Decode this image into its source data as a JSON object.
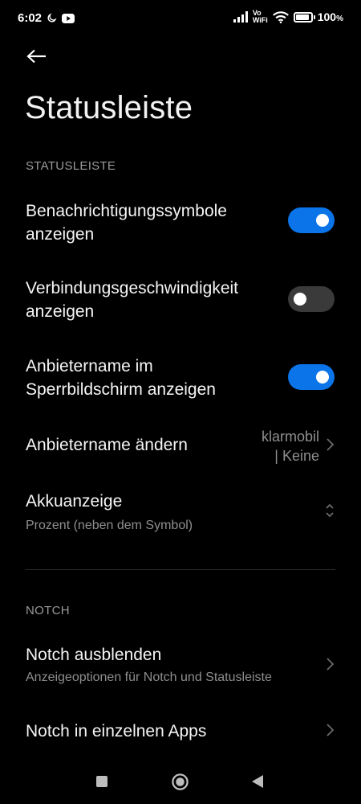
{
  "status_bar": {
    "time": "6:02",
    "vowifi_top": "Vo",
    "vowifi_bottom": "WiFi",
    "battery_text": "100",
    "battery_level": 1.0,
    "icons": [
      "moon-icon",
      "youtube-icon",
      "signal-icon",
      "vowifi-icon",
      "wifi-icon",
      "battery-icon"
    ]
  },
  "header": {
    "back_icon": "back-arrow-icon",
    "title": "Statusleiste"
  },
  "sections": {
    "statusleiste_header": "STATUSLEISTE",
    "notch_header": "NOTCH"
  },
  "settings": {
    "notification_icons": {
      "line1": "Benachrichtigungssymbole",
      "line2": "anzeigen",
      "enabled": true
    },
    "connection_speed": {
      "line1": "Verbindungsgeschwindigkeit",
      "line2": "anzeigen",
      "enabled": false
    },
    "carrier_lockscreen": {
      "line1": "Anbietername im",
      "line2": "Sperrbildschirm anzeigen",
      "enabled": true
    },
    "carrier_name": {
      "title": "Anbietername ändern",
      "value_line1": "klarmobil",
      "value_line2": "| Keine"
    },
    "battery_indicator": {
      "title": "Akkuanzeige",
      "subtitle": "Prozent (neben dem Symbol)"
    },
    "hide_notch": {
      "title": "Notch ausblenden",
      "subtitle": "Anzeigeoptionen für Notch und Statusleiste"
    },
    "notch_apps": {
      "title": "Notch in einzelnen Apps"
    }
  },
  "nav_bar": {
    "icons": [
      "recents-square-icon",
      "home-circle-icon",
      "back-triangle-icon"
    ]
  },
  "colors": {
    "background": "#000000",
    "accent": "#0a74e8",
    "toggle_off": "#3a3a3a",
    "secondary_text": "#8e8e8e"
  }
}
